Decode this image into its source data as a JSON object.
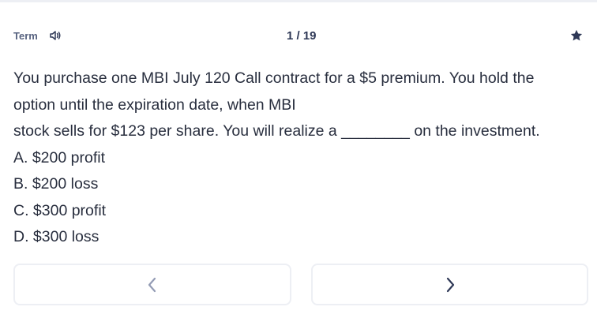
{
  "header": {
    "term_label": "Term",
    "audio_icon": "speaker-icon",
    "counter": "1 / 19",
    "star_icon": "star-icon"
  },
  "question": {
    "lines": [
      "You purchase one MBI July 120 Call contract for a $5 premium. You hold the",
      "option until the expiration date, when MBI",
      "stock sells for $123 per share. You will realize a ________ on the investment.",
      "A. $200 profit",
      "B. $200 loss",
      "C. $300 profit",
      "D. $300 loss"
    ]
  },
  "nav": {
    "prev_icon": "chevron-left-icon",
    "next_icon": "chevron-right-icon"
  },
  "colors": {
    "text": "#282e3e",
    "muted": "#586380",
    "border": "#edeff4",
    "icon": "#2e3856",
    "icon_disabled": "#939bb4"
  }
}
